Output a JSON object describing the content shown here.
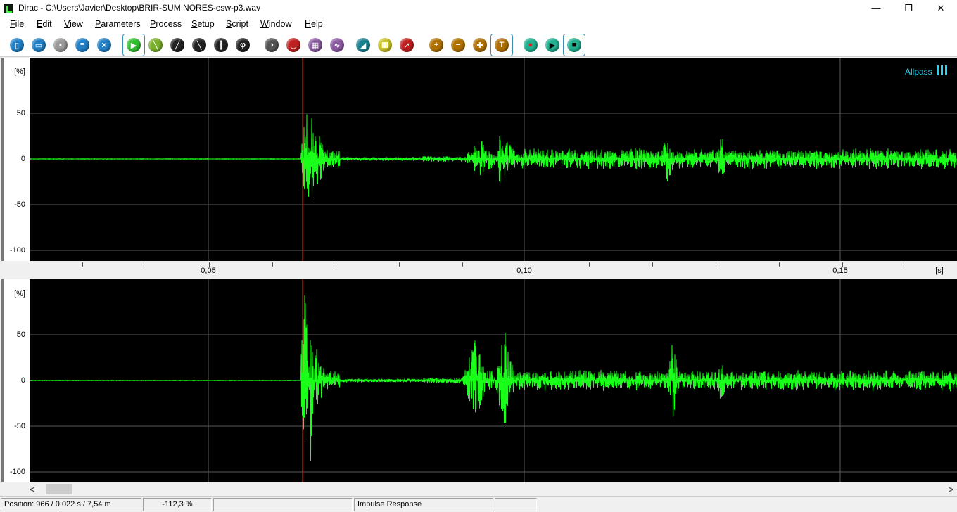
{
  "window": {
    "title": "Dirac - C:\\Users\\Javier\\Desktop\\BRIR-SUM NORES-esw-p3.wav",
    "controls": {
      "minimize": "—",
      "restore": "❐",
      "close": "✕"
    }
  },
  "menu": [
    {
      "label": "File",
      "u": "F",
      "rest": "ile"
    },
    {
      "label": "Edit",
      "u": "E",
      "rest": "dit"
    },
    {
      "label": "View",
      "u": "V",
      "rest": "iew"
    },
    {
      "label": "Parameters",
      "u": "P",
      "rest": "arameters"
    },
    {
      "label": "Process",
      "u": "P",
      "rest": "rocess"
    },
    {
      "label": "Setup",
      "u": "S",
      "rest": "etup"
    },
    {
      "label": "Script",
      "u": "S",
      "rest": "cript"
    },
    {
      "label": "Window",
      "u": "W",
      "rest": "indow"
    },
    {
      "label": "Help",
      "u": "H",
      "rest": "elp"
    }
  ],
  "toolbar": [
    {
      "name": "new-file-icon",
      "color": "#1f7fc6"
    },
    {
      "name": "open-file-icon",
      "color": "#1f7fc6"
    },
    {
      "name": "save-icon",
      "color": "#9a9a9a"
    },
    {
      "name": "print-icon",
      "color": "#1f7fc6"
    },
    {
      "name": "close-file-icon",
      "color": "#1f7fc6"
    },
    {
      "name": "impulse-response-view-icon",
      "color": "#30c030",
      "selected": true
    },
    {
      "name": "energy-time-view-icon",
      "color": "#7ab02a"
    },
    {
      "name": "decay-view-icon",
      "color": "#222222"
    },
    {
      "name": "schroeder-view-icon",
      "color": "#222222"
    },
    {
      "name": "filter-bank-view-icon",
      "color": "#222222"
    },
    {
      "name": "phase-view-icon",
      "color": "#222222"
    },
    {
      "name": "spectrum-color-icon",
      "color": "#555555"
    },
    {
      "name": "shield-icon",
      "color": "#c02020"
    },
    {
      "name": "table-grid-icon",
      "color": "#8a5aa0"
    },
    {
      "name": "frequency-response-icon",
      "color": "#8a5aa0"
    },
    {
      "name": "measure-parameter-icon",
      "color": "#1a7f8f"
    },
    {
      "name": "octave-bands-icon",
      "color": "#c8c020"
    },
    {
      "name": "pointer-arrow-icon",
      "color": "#c02020"
    },
    {
      "name": "zoom-in-icon",
      "color": "#b07000"
    },
    {
      "name": "zoom-out-icon",
      "color": "#b07000"
    },
    {
      "name": "zoom-fit-icon",
      "color": "#b07000"
    },
    {
      "name": "marker-icon",
      "color": "#b07000",
      "selected": true
    },
    {
      "name": "record-icon",
      "color": "#20b090"
    },
    {
      "name": "play-icon",
      "color": "#20b090"
    },
    {
      "name": "stop-icon",
      "color": "#20b090",
      "selected": true
    }
  ],
  "panels": {
    "top": {
      "unit": "[%]",
      "yticks": [
        "50",
        "0",
        "-50",
        "-100"
      ],
      "filter_label": "Allpass"
    },
    "bottom": {
      "unit": "[%]",
      "yticks": [
        "50",
        "0",
        "-50",
        "-100"
      ]
    }
  },
  "time_axis": {
    "labels": [
      "0,05",
      "0,10",
      "0,15"
    ],
    "unit": "[s]"
  },
  "colors": {
    "trace": "#1aff1a",
    "cursor": "#ff2020",
    "grid": "#5a5a5a",
    "filter_label": "#2ad4f0"
  },
  "status": {
    "position": "Position: 966 / 0,022 s / 7,54 m",
    "level": "-112,3 %",
    "empty1": "",
    "mode": "Impulse Response",
    "empty2": ""
  },
  "scrollbar": {
    "left_arrow": "<",
    "right_arrow": ">"
  }
}
